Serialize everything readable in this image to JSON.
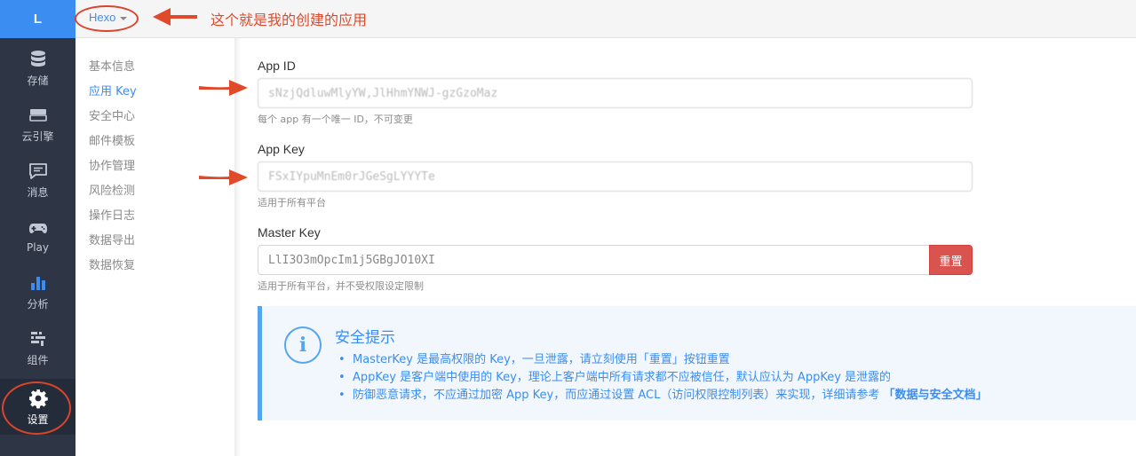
{
  "rail": {
    "logo": "L",
    "items": [
      {
        "label": "存储",
        "icon": "database-icon"
      },
      {
        "label": "云引擎",
        "icon": "server-icon"
      },
      {
        "label": "消息",
        "icon": "message-icon"
      },
      {
        "label": "Play",
        "icon": "gamepad-icon"
      },
      {
        "label": "分析",
        "icon": "bar-chart-icon"
      },
      {
        "label": "组件",
        "icon": "components-icon"
      },
      {
        "label": "设置",
        "icon": "gear-icon",
        "active": true
      }
    ]
  },
  "topbar": {
    "app_name": "Hexo"
  },
  "subnav": {
    "items": [
      "基本信息",
      "应用 Key",
      "安全中心",
      "邮件模板",
      "协作管理",
      "风险检测",
      "操作日志",
      "数据导出",
      "数据恢复"
    ],
    "active_index": 1
  },
  "fields": {
    "app_id": {
      "label": "App ID",
      "value": "sNzjQdluwMlyYW,JlHhmYNWJ-gzGzoMaz",
      "help": "每个 app 有一个唯一 ID，不可变更"
    },
    "app_key": {
      "label": "App Key",
      "value": "FSxIYpuMnEm0rJGeSgLYYYTe",
      "help": "适用于所有平台"
    },
    "master_key": {
      "label": "Master Key",
      "value": "LlI3O3mOpcIm1j5GBgJO10XI",
      "help": "适用于所有平台，并不受权限设定限制",
      "reset_label": "重置"
    }
  },
  "tip": {
    "icon": "info-icon",
    "title": "安全提示",
    "items": [
      "MasterKey 是最高权限的 Key，一旦泄露，请立刻使用「重置」按钮重置",
      "AppKey 是客户端中使用的 Key，理论上客户端中所有请求都不应被信任，默认应认为 AppKey 是泄露的",
      "防御恶意请求，不应通过加密 App Key，而应通过设置 ACL（访问权限控制列表）来实现，详细请参考 "
    ],
    "link": "「数据与安全文档」"
  },
  "annotation": {
    "text": "这个就是我的创建的应用"
  },
  "colors": {
    "accent": "#3b8df2",
    "rail_bg": "#2e3646",
    "danger": "#d9534f",
    "annotation": "#e04a2b"
  }
}
